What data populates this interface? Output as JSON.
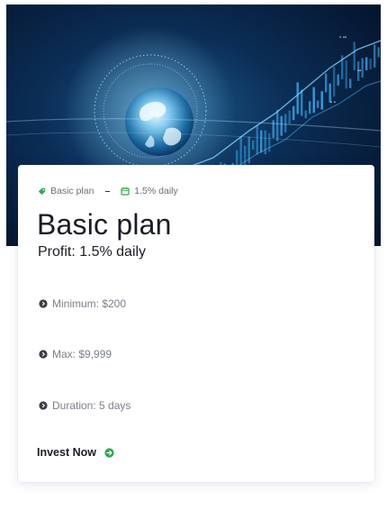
{
  "plan": {
    "tag_label": "Basic plan",
    "separator": "–",
    "rate_label": "1.5% daily",
    "title": "Basic plan",
    "profit": "Profit: 1.5% daily",
    "features": [
      {
        "icon": "chevron-right-circle-icon",
        "text": "Minimum: $200"
      },
      {
        "icon": "chevron-right-circle-icon",
        "text": "Max: $9,999"
      },
      {
        "icon": "chevron-right-circle-icon",
        "text": "Duration: 5 days"
      }
    ],
    "cta_label": "Invest Now",
    "cta_icon": "arrow-right-circle-icon"
  },
  "hero": {
    "image": "digital-globe-with-financial-chart"
  },
  "colors": {
    "accent_green": "#2fa84f",
    "text_dark": "#1a1d24",
    "text_muted": "#7b7f88",
    "hero_bg": "#061a33"
  }
}
